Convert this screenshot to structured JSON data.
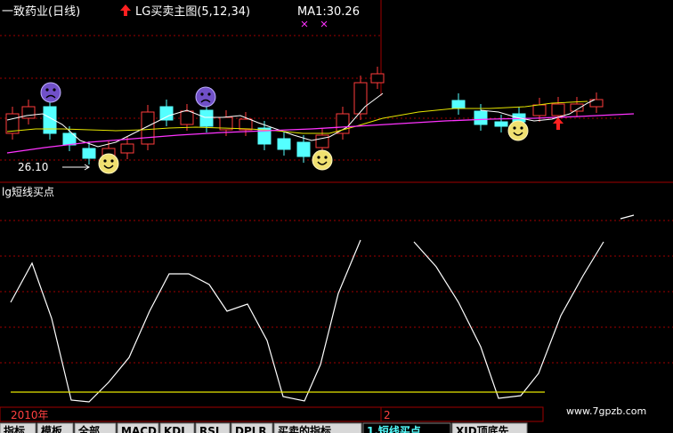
{
  "stock_title": "一致药业(日线)",
  "indicator_name": "LG买卖主图(5,12,34)",
  "ma1_text": "MA1:30.26",
  "low_price_label": "26.10",
  "sub_indicator_label": "lg短线买点",
  "year_label": "2010年",
  "timeline_marker": "2",
  "watermark": "www.7gpzb.com",
  "tabs": [
    "指标",
    "模板",
    "全部",
    "MACD",
    "KDJ",
    "RSI",
    "DPLR",
    "买卖的指标",
    "1.短线买点",
    "XJD顶底先"
  ],
  "colors": {
    "background": "#000000",
    "up_candle": "#ff3c3c",
    "down_candle": "#54ffff",
    "ma_white": "#ffffff",
    "ma_yellow": "#e6e600",
    "ma_magenta": "#ff33ff",
    "grid_red": "#a00000",
    "oscillator": "#ffffff",
    "threshold": "#e6e600",
    "arrow_red": "#ff2020",
    "title_white": "#ffffff",
    "tab_active": "#54ffff"
  }
}
